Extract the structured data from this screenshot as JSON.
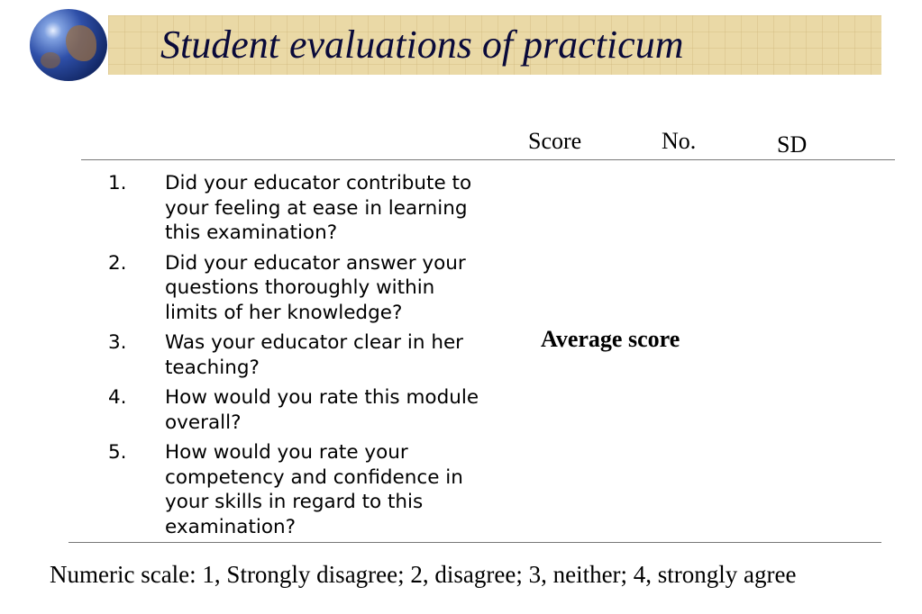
{
  "slide": {
    "title": "Student evaluations of practicum"
  },
  "table": {
    "columns": {
      "score": "Score",
      "no": "No.",
      "sd": "SD"
    },
    "questions": [
      {
        "num": "1.",
        "text": "Did your educator contribute to your feeling at ease in learning this examination?"
      },
      {
        "num": "2.",
        "text": "Did your educator answer your questions thoroughly within limits of her knowledge?"
      },
      {
        "num": "3.",
        "text": "Was your educator clear in her teaching?"
      },
      {
        "num": "4.",
        "text": "How would you rate this module overall?"
      },
      {
        "num": "5.",
        "text": "How would you rate your competency and confidence in your skills in regard to this examination?"
      }
    ],
    "average_label": "Average score"
  },
  "footnote": "Numeric scale: 1, Strongly disagree; 2, disagree; 3, neither; 4, strongly agree",
  "colors": {
    "banner": "#ead9a6",
    "title_text": "#0a0a3a",
    "rule": "#777777"
  },
  "icons": {
    "logo": "globe-icon"
  }
}
